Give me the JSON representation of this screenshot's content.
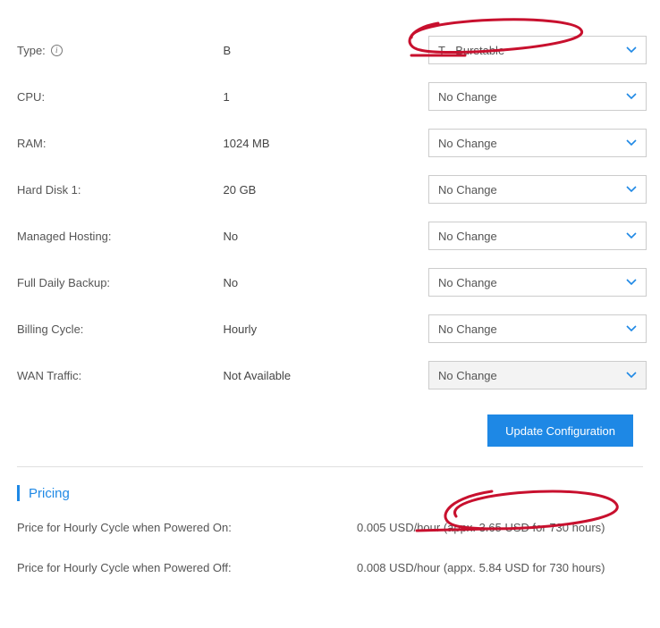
{
  "rows": [
    {
      "label": "Type:",
      "info": true,
      "value": "B",
      "select": "T - Burstable",
      "disabled": false
    },
    {
      "label": "CPU:",
      "info": false,
      "value": "1",
      "select": "No Change",
      "disabled": false
    },
    {
      "label": "RAM:",
      "info": false,
      "value": "1024 MB",
      "select": "No Change",
      "disabled": false
    },
    {
      "label": "Hard Disk 1:",
      "info": false,
      "value": "20 GB",
      "select": "No Change",
      "disabled": false
    },
    {
      "label": "Managed Hosting:",
      "info": false,
      "value": "No",
      "select": "No Change",
      "disabled": false
    },
    {
      "label": "Full Daily Backup:",
      "info": false,
      "value": "No",
      "select": "No Change",
      "disabled": false
    },
    {
      "label": "Billing Cycle:",
      "info": false,
      "value": "Hourly",
      "select": "No Change",
      "disabled": false
    },
    {
      "label": "WAN Traffic:",
      "info": false,
      "value": "Not Available",
      "select": "No Change",
      "disabled": true
    }
  ],
  "updateButton": "Update Configuration",
  "pricing": {
    "heading": "Pricing",
    "rows": [
      {
        "label": "Price for Hourly Cycle when Powered On:",
        "value": "0.005 USD/hour (appx. 3.65 USD for 730 hours)"
      },
      {
        "label": "Price for Hourly Cycle when Powered Off:",
        "value": "0.008 USD/hour (appx. 5.84 USD for 730 hours)"
      }
    ]
  }
}
